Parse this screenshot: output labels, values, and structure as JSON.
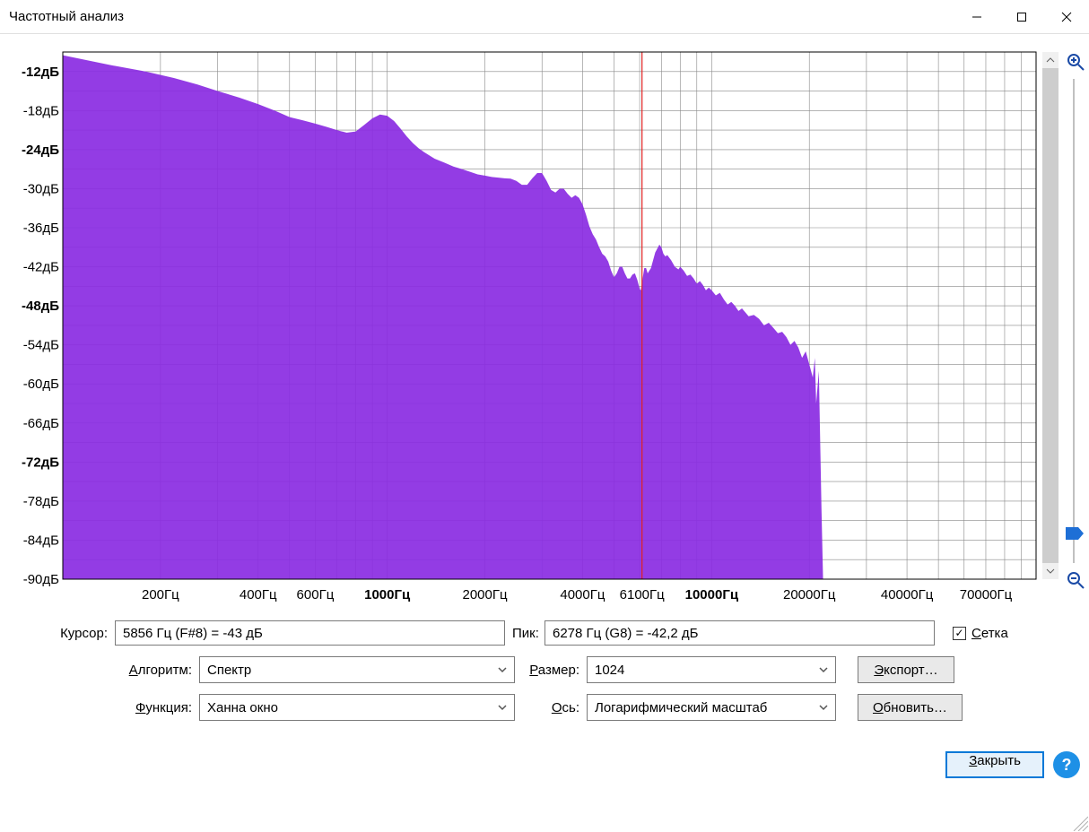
{
  "window": {
    "title": "Частотный анализ"
  },
  "chart_data": {
    "type": "area",
    "title": "",
    "x_unit": "Гц",
    "y_unit": "дБ",
    "x_scale": "log",
    "x_min": 100,
    "x_max": 100000,
    "y_min": -90,
    "y_max": -9,
    "y_ticks": [
      -12,
      -18,
      -24,
      -30,
      -36,
      -42,
      -48,
      -54,
      -60,
      -66,
      -72,
      -78,
      -84,
      -90
    ],
    "y_bold": [
      -12,
      -24,
      -48,
      -72
    ],
    "x_ticks": [
      200,
      400,
      600,
      1000,
      2000,
      4000,
      6100,
      10000,
      20000,
      40000,
      70000
    ],
    "x_bold": [
      1000,
      10000
    ],
    "cursor_x": 6100,
    "series": [
      {
        "name": "spectrum",
        "color": "#8a2be2",
        "points": [
          [
            100,
            -9.5
          ],
          [
            140,
            -11
          ],
          [
            180,
            -12
          ],
          [
            220,
            -13
          ],
          [
            260,
            -14
          ],
          [
            300,
            -15
          ],
          [
            350,
            -16
          ],
          [
            400,
            -17
          ],
          [
            450,
            -18
          ],
          [
            500,
            -19
          ],
          [
            550,
            -19.5
          ],
          [
            600,
            -20
          ],
          [
            650,
            -20.5
          ],
          [
            700,
            -21
          ],
          [
            750,
            -21.4
          ],
          [
            800,
            -21.2
          ],
          [
            850,
            -20.2
          ],
          [
            900,
            -19.2
          ],
          [
            950,
            -18.6
          ],
          [
            1000,
            -18.8
          ],
          [
            1050,
            -19.6
          ],
          [
            1100,
            -20.8
          ],
          [
            1150,
            -22
          ],
          [
            1200,
            -23
          ],
          [
            1250,
            -23.8
          ],
          [
            1300,
            -24.4
          ],
          [
            1400,
            -25.4
          ],
          [
            1500,
            -26
          ],
          [
            1600,
            -26.6
          ],
          [
            1700,
            -27
          ],
          [
            1800,
            -27.4
          ],
          [
            1900,
            -27.8
          ],
          [
            2000,
            -28
          ],
          [
            2100,
            -28.2
          ],
          [
            2200,
            -28.3
          ],
          [
            2300,
            -28.4
          ],
          [
            2400,
            -28.45
          ],
          [
            2500,
            -28.8
          ],
          [
            2600,
            -29.4
          ],
          [
            2700,
            -29.4
          ],
          [
            2800,
            -28.4
          ],
          [
            2900,
            -27.6
          ],
          [
            3000,
            -27.6
          ],
          [
            3100,
            -28.8
          ],
          [
            3200,
            -30.2
          ],
          [
            3300,
            -30.6
          ],
          [
            3400,
            -30
          ],
          [
            3500,
            -30
          ],
          [
            3600,
            -30.8
          ],
          [
            3700,
            -31.4
          ],
          [
            3800,
            -31
          ],
          [
            3900,
            -31.4
          ],
          [
            4000,
            -32.4
          ],
          [
            4100,
            -34
          ],
          [
            4200,
            -35.8
          ],
          [
            4300,
            -37
          ],
          [
            4400,
            -37.8
          ],
          [
            4500,
            -39
          ],
          [
            4600,
            -40
          ],
          [
            4700,
            -40.4
          ],
          [
            4800,
            -41.2
          ],
          [
            4900,
            -42.6
          ],
          [
            5000,
            -43.6
          ],
          [
            5100,
            -43
          ],
          [
            5200,
            -42
          ],
          [
            5300,
            -42
          ],
          [
            5400,
            -43
          ],
          [
            5500,
            -43.8
          ],
          [
            5600,
            -43.8
          ],
          [
            5700,
            -43.2
          ],
          [
            5800,
            -43
          ],
          [
            5900,
            -44
          ],
          [
            6000,
            -45.4
          ],
          [
            6050,
            -45.6
          ],
          [
            6100,
            -44.4
          ],
          [
            6200,
            -42.2
          ],
          [
            6278,
            -42.2
          ],
          [
            6350,
            -43
          ],
          [
            6500,
            -42.2
          ],
          [
            6700,
            -39.8
          ],
          [
            6900,
            -38.6
          ],
          [
            7000,
            -39
          ],
          [
            7100,
            -40
          ],
          [
            7200,
            -40.4
          ],
          [
            7300,
            -40.2
          ],
          [
            7500,
            -41
          ],
          [
            7700,
            -42
          ],
          [
            7900,
            -42.4
          ],
          [
            8000,
            -42
          ],
          [
            8200,
            -42.6
          ],
          [
            8400,
            -43.4
          ],
          [
            8600,
            -43.2
          ],
          [
            8800,
            -43.8
          ],
          [
            9000,
            -44.6
          ],
          [
            9200,
            -44.2
          ],
          [
            9400,
            -44.8
          ],
          [
            9600,
            -45.6
          ],
          [
            9800,
            -45.2
          ],
          [
            10000,
            -45.6
          ],
          [
            10300,
            -46.4
          ],
          [
            10600,
            -46
          ],
          [
            10900,
            -47
          ],
          [
            11200,
            -47.8
          ],
          [
            11500,
            -47.4
          ],
          [
            11800,
            -48
          ],
          [
            12100,
            -48.8
          ],
          [
            12400,
            -48.4
          ],
          [
            12700,
            -49
          ],
          [
            13000,
            -49.6
          ],
          [
            13500,
            -49.4
          ],
          [
            14000,
            -50
          ],
          [
            14500,
            -51
          ],
          [
            15000,
            -50.6
          ],
          [
            15500,
            -51.4
          ],
          [
            16000,
            -52.2
          ],
          [
            16500,
            -52
          ],
          [
            17000,
            -52.8
          ],
          [
            17500,
            -54
          ],
          [
            18000,
            -53.4
          ],
          [
            18500,
            -54.4
          ],
          [
            19000,
            -56
          ],
          [
            19500,
            -55
          ],
          [
            20000,
            -57
          ],
          [
            20500,
            -59
          ],
          [
            20800,
            -56
          ],
          [
            21000,
            -63
          ],
          [
            21400,
            -58
          ],
          [
            21800,
            -79
          ],
          [
            22050,
            -90
          ]
        ]
      }
    ]
  },
  "readouts": {
    "cursor_label": "Курсор:",
    "cursor_value": "5856 Гц (F#8) = -43 дБ",
    "peak_label": "Пик:",
    "peak_value": "6278 Гц (G8) = -42,2 дБ"
  },
  "grid_checkbox": {
    "checked": true,
    "label_u": "С",
    "label_rest": "етка"
  },
  "controls": {
    "algorithm": {
      "label_u": "А",
      "label_rest": "лгоритм:",
      "value": "Спектр"
    },
    "size": {
      "label_u": "Р",
      "label_rest": "азмер:",
      "value": "1024"
    },
    "function": {
      "label_u": "Ф",
      "label_rest": "ункция:",
      "value": "Ханна  окно"
    },
    "axis": {
      "label_u": "О",
      "label_rest": "сь:",
      "value": "Логарифмический масштаб"
    }
  },
  "buttons": {
    "export": {
      "u": "Э",
      "rest": "кспорт…"
    },
    "refresh": {
      "u": "О",
      "rest": "бновить…"
    },
    "close": {
      "u": "З",
      "rest": "акрыть"
    }
  }
}
